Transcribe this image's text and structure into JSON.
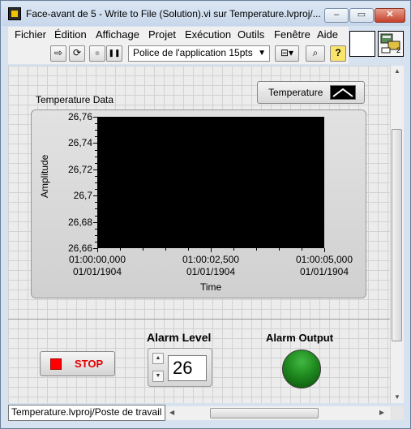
{
  "window": {
    "title": "Face-avant de 5 - Write to File (Solution).vi sur Temperature.lvproj/...",
    "minimize_glyph": "–",
    "maximize_glyph": "▭",
    "close_glyph": "✕"
  },
  "menubar": {
    "items": [
      "Fichier",
      "Édition",
      "Affichage",
      "Projet",
      "Exécution",
      "Outils",
      "Fenêtre",
      "Aide"
    ]
  },
  "toolbar": {
    "run_glyph": "⇨",
    "run_continuous_glyph": "⟳",
    "abort_glyph": "●",
    "pause_glyph": "❚❚",
    "font_label": "Police de l'application 15pts",
    "font_arrow": "▼",
    "align_glyph": "⊟",
    "align_arrow": "▾",
    "search_glyph": "⌕",
    "help_glyph": "?",
    "connector_number": "2"
  },
  "chart": {
    "label": "Temperature Data",
    "legend_name": "Temperature"
  },
  "chart_data": {
    "type": "line",
    "title": "Temperature Data",
    "xlabel": "Time",
    "ylabel": "Amplitude",
    "y_ticks": [
      "26,76",
      "26,74",
      "26,72",
      "26,7",
      "26,68",
      "26,66"
    ],
    "ylim": [
      26.66,
      26.76
    ],
    "x_ticks": [
      {
        "time": "01:00:00,000",
        "date": "01/01/1904"
      },
      {
        "time": "01:00:02,500",
        "date": "01/01/1904"
      },
      {
        "time": "01:00:05,000",
        "date": "01/01/1904"
      }
    ],
    "series": [
      {
        "name": "Temperature",
        "values": []
      }
    ],
    "grid": false,
    "legend_position": "top-right",
    "plot_background": "#000000"
  },
  "controls": {
    "stop_label": "STOP",
    "alarm_level_label": "Alarm Level",
    "alarm_level_value": "26",
    "alarm_output_label": "Alarm Output",
    "alarm_output_state": "on",
    "led_color": "#1f8a1f"
  },
  "statusbar": {
    "project_path": "Temperature.lvproj/Poste de travail"
  },
  "scroll": {
    "up": "▲",
    "down": "▼",
    "left": "◀",
    "right": "▶"
  }
}
